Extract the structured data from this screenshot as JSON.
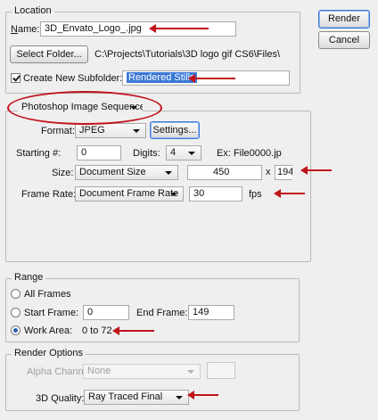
{
  "location": {
    "legend": "Location",
    "name_label_u": "N",
    "name_label_rest": "ame:",
    "name_value": "3D_Envato_Logo_.jpg",
    "select_folder_label": "Select Folder...",
    "folder_path": "C:\\Projects\\Tutorials\\3D logo gif CS6\\Files\\",
    "create_subfolder_checked": true,
    "create_subfolder_label": "Create New Subfolder:",
    "subfolder_value": "Rendered Stills"
  },
  "buttons": {
    "render": "Render",
    "cancel": "Cancel"
  },
  "format_section": {
    "type_select": "Photoshop Image Sequence",
    "format_label": "Format:",
    "format_value": "JPEG",
    "settings_label": "Settings...",
    "starting_label": "Starting #:",
    "starting_value": "0",
    "digits_label": "Digits:",
    "digits_value": "4",
    "example": "Ex: File0000.jp",
    "size_label": "Size:",
    "size_select": "Document Size",
    "width_value": "450",
    "x_label": "x",
    "height_value": "194",
    "frame_rate_label": "Frame Rate:",
    "frame_rate_select": "Document Frame Rate",
    "fps_value": "30",
    "fps_label": "fps"
  },
  "range": {
    "legend": "Range",
    "all_frames": "All Frames",
    "start_frame_label": "Start Frame:",
    "start_frame_value": "0",
    "end_frame_label": "End Frame:",
    "end_frame_value": "149",
    "work_area_label": "Work Area:",
    "work_area_value": "0 to 72",
    "selected": "work_area"
  },
  "render_options": {
    "legend": "Render Options",
    "alpha_label": "Alpha Channel:",
    "alpha_value": "None",
    "quality_label": "3D Quality:",
    "quality_value": "Ray Traced Final"
  },
  "colors": {
    "annotation_red": "#c0141b",
    "selection_blue": "#3a78d6"
  }
}
